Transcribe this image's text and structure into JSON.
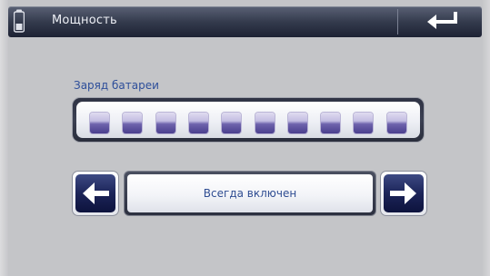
{
  "header": {
    "title": "Мощность",
    "icon": "battery-icon",
    "back_icon": "return-arrow-icon"
  },
  "battery": {
    "label": "Заряд батареи",
    "cells_total": 10,
    "cells_filled": 10,
    "cell_color": "#4a3f8d"
  },
  "power_mode": {
    "value": "Всегда включен",
    "prev_icon": "arrow-left-icon",
    "next_icon": "arrow-right-icon"
  },
  "colors": {
    "background": "#c4c5c8",
    "title_bar": "#343b4d",
    "accent_text": "#2d4e9a",
    "button_face": "#1c2458"
  }
}
